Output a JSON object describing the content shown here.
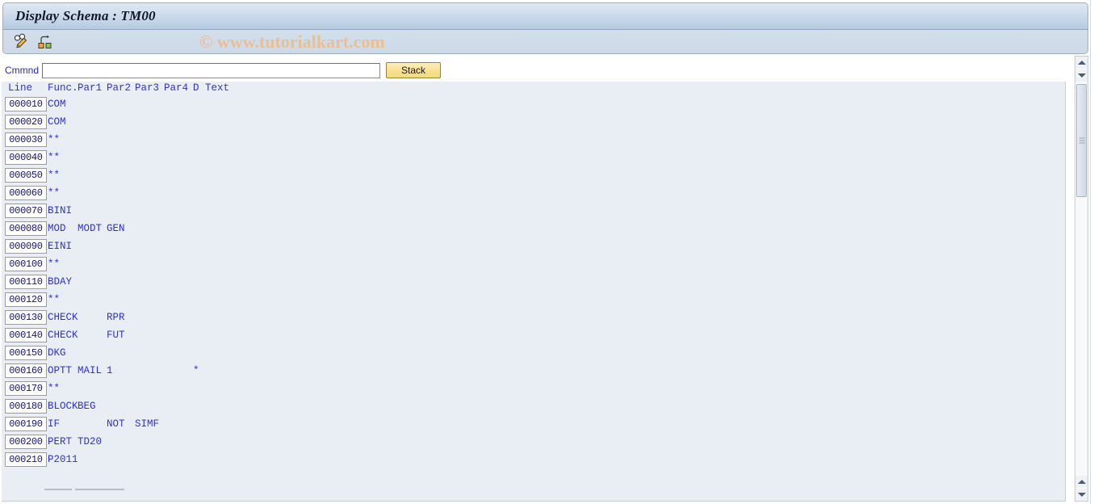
{
  "window": {
    "title": "Display Schema : TM00"
  },
  "toolbar": {
    "buttons": [
      {
        "name": "display-change-toggle",
        "icon": "pencil-glasses-icon",
        "tooltip": "Display <-> Change"
      },
      {
        "name": "structure-button",
        "icon": "hierarchy-icon",
        "tooltip": "Structure"
      }
    ],
    "watermark": "© www.tutorialkart.com"
  },
  "command": {
    "label": "Cmmnd",
    "value": "",
    "placeholder": "",
    "stack_label": "Stack"
  },
  "table": {
    "headers": {
      "line": "Line",
      "func": "Func.",
      "par1": "Par1",
      "par2": "Par2",
      "par3": "Par3",
      "par4": "Par4",
      "d": "D",
      "text": "Text"
    },
    "rows": [
      {
        "line": "000010",
        "func": "COM",
        "par1": "",
        "par2": "",
        "par3": "",
        "par4": "",
        "d": "",
        "text": ""
      },
      {
        "line": "000020",
        "func": "COM",
        "par1": "",
        "par2": "",
        "par3": "",
        "par4": "",
        "d": "",
        "text": ""
      },
      {
        "line": "000030",
        "func": "**",
        "par1": "",
        "par2": "",
        "par3": "",
        "par4": "",
        "d": "",
        "text": ""
      },
      {
        "line": "000040",
        "func": "**",
        "par1": "",
        "par2": "",
        "par3": "",
        "par4": "",
        "d": "",
        "text": ""
      },
      {
        "line": "000050",
        "func": "**",
        "par1": "",
        "par2": "",
        "par3": "",
        "par4": "",
        "d": "",
        "text": ""
      },
      {
        "line": "000060",
        "func": "**",
        "par1": "",
        "par2": "",
        "par3": "",
        "par4": "",
        "d": "",
        "text": ""
      },
      {
        "line": "000070",
        "func": "BINI",
        "par1": "",
        "par2": "",
        "par3": "",
        "par4": "",
        "d": "",
        "text": ""
      },
      {
        "line": "000080",
        "func": "MOD",
        "par1": "MODT",
        "par2": "GEN",
        "par3": "",
        "par4": "",
        "d": "",
        "text": ""
      },
      {
        "line": "000090",
        "func": "EINI",
        "par1": "",
        "par2": "",
        "par3": "",
        "par4": "",
        "d": "",
        "text": ""
      },
      {
        "line": "000100",
        "func": "**",
        "par1": "",
        "par2": "",
        "par3": "",
        "par4": "",
        "d": "",
        "text": ""
      },
      {
        "line": "000110",
        "func": "BDAY",
        "par1": "",
        "par2": "",
        "par3": "",
        "par4": "",
        "d": "",
        "text": ""
      },
      {
        "line": "000120",
        "func": "**",
        "par1": "",
        "par2": "",
        "par3": "",
        "par4": "",
        "d": "",
        "text": ""
      },
      {
        "line": "000130",
        "func": "CHECK",
        "par1": "",
        "par2": "RPR",
        "par3": "",
        "par4": "",
        "d": "",
        "text": ""
      },
      {
        "line": "000140",
        "func": "CHECK",
        "par1": "",
        "par2": "FUT",
        "par3": "",
        "par4": "",
        "d": "",
        "text": ""
      },
      {
        "line": "000150",
        "func": "DKG",
        "par1": "",
        "par2": "",
        "par3": "",
        "par4": "",
        "d": "",
        "text": ""
      },
      {
        "line": "000160",
        "func": "OPTT",
        "par1": "MAIL",
        "par2": "1",
        "par3": "",
        "par4": "",
        "d": "*",
        "text": ""
      },
      {
        "line": "000170",
        "func": "**",
        "par1": "",
        "par2": "",
        "par3": "",
        "par4": "",
        "d": "",
        "text": ""
      },
      {
        "line": "000180",
        "func": "BLOCK",
        "par1": "BEG",
        "par2": "",
        "par3": "",
        "par4": "",
        "d": "",
        "text": ""
      },
      {
        "line": "000190",
        "func": "IF",
        "par1": "",
        "par2": "NOT",
        "par3": "SIMF",
        "par4": "",
        "d": "",
        "text": ""
      },
      {
        "line": "000200",
        "func": "PERT",
        "par1": "TD20",
        "par2": "",
        "par3": "",
        "par4": "",
        "d": "",
        "text": ""
      },
      {
        "line": "000210",
        "func": "P2011",
        "par1": "",
        "par2": "",
        "par3": "",
        "par4": "",
        "d": "",
        "text": ""
      }
    ]
  },
  "scrollbar": {
    "up_arrow": "scroll-up",
    "down_arrow": "scroll-down"
  },
  "colors": {
    "title_text": "#111827",
    "field_text": "#3333cc",
    "line_number_text": "#13137d",
    "watermark": "#eabf93",
    "stack_button": "#f3d97f",
    "content_background": "#e9eef5"
  }
}
